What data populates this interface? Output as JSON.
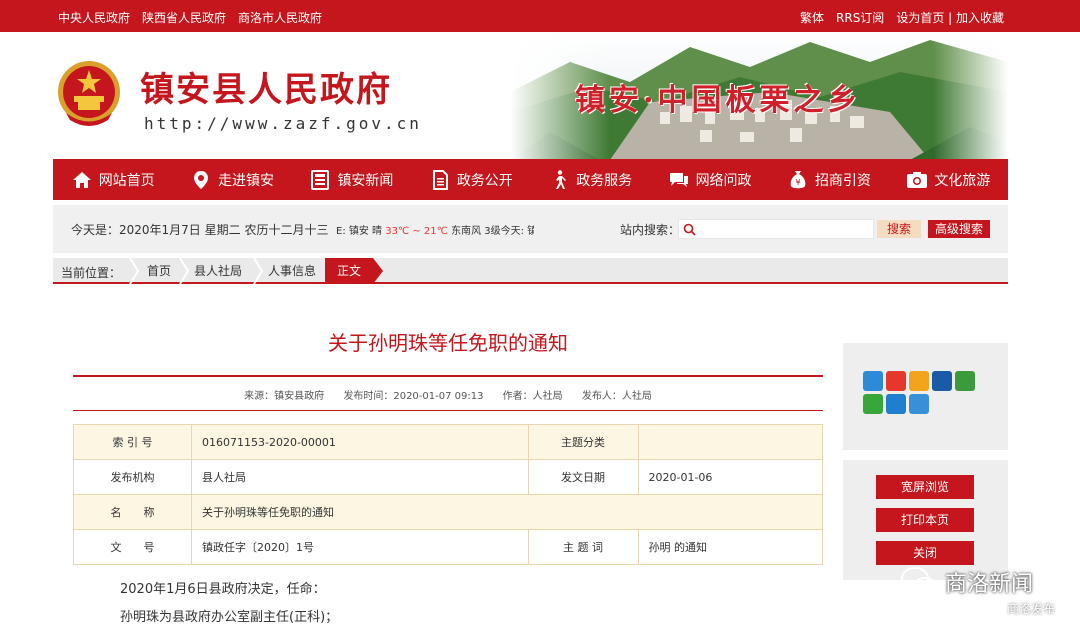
{
  "top_links": {
    "left": [
      "中央人民政府",
      "陕西省人民政府",
      "商洛市人民政府"
    ],
    "right": [
      "繁体",
      "RRS订阅",
      "设为首页 | 加入收藏"
    ]
  },
  "header": {
    "title": "镇安县人民政府",
    "url": "http://www.zazf.gov.cn",
    "banner_text": "镇安·中国板栗之乡"
  },
  "nav": [
    "网站首页",
    "走进镇安",
    "镇安新闻",
    "政务公开",
    "政务服务",
    "网络问政",
    "招商引资",
    "文化旅游"
  ],
  "info": {
    "date": "今天是：2020年1月7日  星期二  农历十二月十三",
    "weather_prefix": "E: 镇安 晴 ",
    "weather_temp": "33℃ ~ 21℃",
    "weather_suffix": " 东南风 3级今天: 镇",
    "search_label": "站内搜索：",
    "search_placeholder": "",
    "search_button": "搜索",
    "advanced_button": "高级搜索"
  },
  "breadcrumb": {
    "label": "当前位置：",
    "items": [
      "首页",
      "县人社局",
      "人事信息",
      "正文"
    ]
  },
  "article": {
    "title": "关于孙明珠等任免职的通知",
    "meta": {
      "source": "来源：镇安县政府",
      "time": "发布时间：2020-01-07 09:13",
      "author": "作者：人社局",
      "publisher": "发布人：人社局"
    },
    "table": [
      [
        "索 引 号",
        "016071153-2020-00001",
        "主题分类",
        ""
      ],
      [
        "发布机构",
        "县人社局",
        "发文日期",
        "2020-01-06"
      ],
      [
        "名　　称",
        "关于孙明珠等任免职的通知"
      ],
      [
        "文　　号",
        "镇政任字〔2020〕1号",
        "主 题 词",
        "孙明 的通知"
      ]
    ],
    "body": [
      "2020年1月6日县政府决定，任命：",
      "孙明珠为县政府办公室副主任(正科)；"
    ]
  },
  "sidebar": {
    "buttons": [
      "宽屏浏览",
      "打印本页",
      "关闭"
    ]
  },
  "watermark": {
    "name": "商洛新闻",
    "sub": "商洛发布"
  },
  "colors": {
    "brand_red": "#c4161c",
    "table_bg": "#fdf6e3"
  }
}
